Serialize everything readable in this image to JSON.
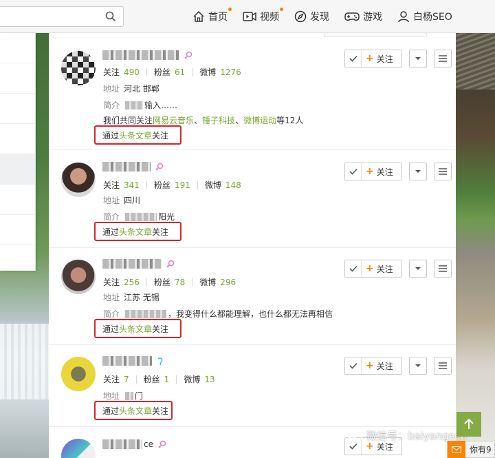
{
  "nav": {
    "search_placeholder": "",
    "items": [
      {
        "label": "首页",
        "icon": "home-icon",
        "dot": true
      },
      {
        "label": "视频",
        "icon": "video-icon",
        "dot": true
      },
      {
        "label": "发现",
        "icon": "discover-icon",
        "dot": false
      },
      {
        "label": "游戏",
        "icon": "gamepad-icon",
        "dot": false
      },
      {
        "label": "白杨SEO",
        "icon": "user-icon",
        "dot": false
      }
    ]
  },
  "buttons": {
    "follow": "关注"
  },
  "labels": {
    "following": "关注",
    "fans": "粉丝",
    "weibo": "微博",
    "address": "地址",
    "intro": "简介"
  },
  "users": [
    {
      "following": "490",
      "fans": "61",
      "weibo": "1276",
      "address": "河北 邯郸",
      "intro_tail": "输入……",
      "common_prefix": "我们共同关注",
      "common_links": [
        "网易云音乐",
        "锤子科技",
        "微博运动"
      ],
      "common_suffix": "等12人",
      "via_prefix": "通过",
      "via_link": "头条文章",
      "via_suffix": "关注"
    },
    {
      "following": "341",
      "fans": "191",
      "weibo": "148",
      "address": "四川",
      "intro_tail": "阳光",
      "via_prefix": "通过",
      "via_link": "头条文章",
      "via_suffix": "关注"
    },
    {
      "following": "256",
      "fans": "78",
      "weibo": "296",
      "address": "江苏 无锡",
      "intro_tail": "，我变得什么都能理解，也什么都无法再相信",
      "via_prefix": "通过",
      "via_link": "头条文章",
      "via_suffix": "关注"
    },
    {
      "following": "7",
      "fans": "1",
      "weibo": "13",
      "address_tail": "门",
      "via_prefix": "通过",
      "via_link": "头条文章",
      "via_suffix": "关注"
    },
    {
      "name_tail": "ce"
    }
  ],
  "watermark": "微信号：baiyangseo",
  "bottom_bar": "你有9",
  "colors": {
    "accent": "#7aa634",
    "orange": "#ff8200",
    "highlight_box": "#d8232a"
  }
}
